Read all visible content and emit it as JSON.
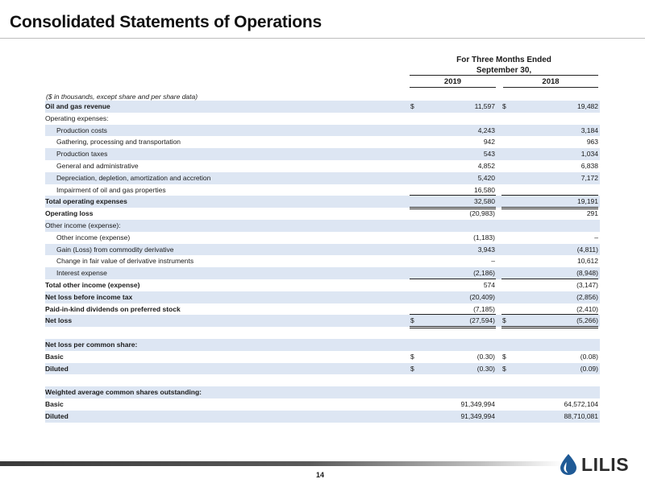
{
  "title": "Consolidated Statements of Operations",
  "header": {
    "group_line1": "For Three Months Ended",
    "group_line2": "September 30,",
    "col_2019": "2019",
    "col_2018": "2018"
  },
  "note": "($ in thousands, except share and per share data)",
  "rows": [
    {
      "label": "Oil and gas revenue",
      "a_cur": "$",
      "a": "11,597",
      "b_cur": "$",
      "b": "19,482"
    },
    {
      "label": "Operating expenses:",
      "a_cur": "",
      "a": "",
      "b_cur": "",
      "b": ""
    },
    {
      "label": "Production costs",
      "a_cur": "",
      "a": "4,243",
      "b_cur": "",
      "b": "3,184"
    },
    {
      "label": "Gathering, processing and transportation",
      "a_cur": "",
      "a": "942",
      "b_cur": "",
      "b": "963"
    },
    {
      "label": "Production taxes",
      "a_cur": "",
      "a": "543",
      "b_cur": "",
      "b": "1,034"
    },
    {
      "label": "General and administrative",
      "a_cur": "",
      "a": "4,852",
      "b_cur": "",
      "b": "6,838"
    },
    {
      "label": "Depreciation, depletion, amortization and accretion",
      "a_cur": "",
      "a": "5,420",
      "b_cur": "",
      "b": "7,172"
    },
    {
      "label": "Impairment of oil and gas properties",
      "a_cur": "",
      "a": "16,580",
      "b_cur": "",
      "b": ""
    },
    {
      "label": "Total operating expenses",
      "a_cur": "",
      "a": "32,580",
      "b_cur": "",
      "b": "19,191"
    },
    {
      "label": "Operating loss",
      "a_cur": "",
      "a": "(20,983)",
      "b_cur": "",
      "b": "291"
    },
    {
      "label": "Other income (expense):",
      "a_cur": "",
      "a": "",
      "b_cur": "",
      "b": ""
    },
    {
      "label": "Other income (expense)",
      "a_cur": "",
      "a": "(1,183)",
      "b_cur": "",
      "b": "–"
    },
    {
      "label": "Gain (Loss) from commodity derivative",
      "a_cur": "",
      "a": "3,943",
      "b_cur": "",
      "b": "(4,811)"
    },
    {
      "label": "Change in fair value of derivative instruments",
      "a_cur": "",
      "a": "–",
      "b_cur": "",
      "b": "10,612"
    },
    {
      "label": "Interest expense",
      "a_cur": "",
      "a": "(2,186)",
      "b_cur": "",
      "b": "(8,948)"
    },
    {
      "label": "Total other income (expense)",
      "a_cur": "",
      "a": "574",
      "b_cur": "",
      "b": "(3,147)"
    },
    {
      "label": "Net loss before income tax",
      "a_cur": "",
      "a": "(20,409)",
      "b_cur": "",
      "b": "(2,856)"
    },
    {
      "label": "Paid-in-kind dividends on preferred stock",
      "a_cur": "",
      "a": "(7,185)",
      "b_cur": "",
      "b": "(2,410)"
    },
    {
      "label": "Net loss",
      "a_cur": "$",
      "a": "(27,594)",
      "b_cur": "$",
      "b": "(5,266)"
    },
    {
      "label": "",
      "a_cur": "",
      "a": "",
      "b_cur": "",
      "b": ""
    },
    {
      "label": "Net loss per common share:",
      "a_cur": "",
      "a": "",
      "b_cur": "",
      "b": ""
    },
    {
      "label": "Basic",
      "a_cur": "$",
      "a": "(0.30)",
      "b_cur": "$",
      "b": "(0.08)"
    },
    {
      "label": "Diluted",
      "a_cur": "$",
      "a": "(0.30)",
      "b_cur": "$",
      "b": "(0.09)"
    },
    {
      "label": "",
      "a_cur": "",
      "a": "",
      "b_cur": "",
      "b": ""
    },
    {
      "label": "Weighted average common shares outstanding:",
      "a_cur": "",
      "a": "",
      "b_cur": "",
      "b": ""
    },
    {
      "label": "Basic",
      "a_cur": "",
      "a": "91,349,994",
      "b_cur": "",
      "b": "64,572,104"
    },
    {
      "label": "Diluted",
      "a_cur": "",
      "a": "91,349,994",
      "b_cur": "",
      "b": "88,710,081"
    }
  ],
  "footer": {
    "page_number": "14",
    "logo_text": "LILIS",
    "logo_icon": "oil-drop-icon",
    "logo_color": "#1f5a96"
  }
}
